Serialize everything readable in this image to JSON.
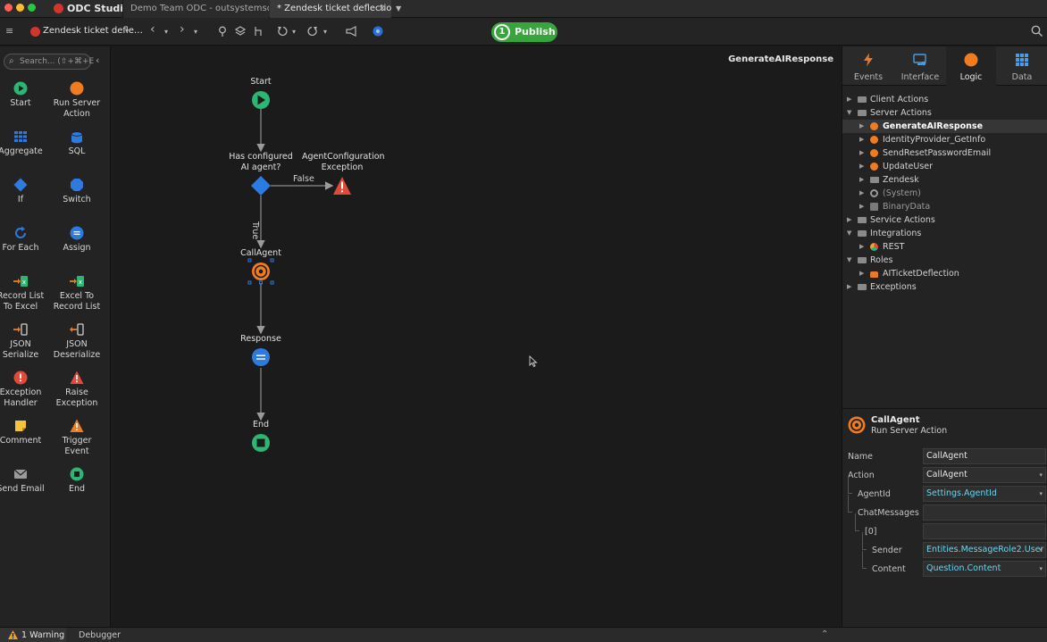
{
  "app": {
    "name": "ODC Studio",
    "window_tabs": [
      {
        "label": "Demo Team ODC - outsystemsdt.ou…",
        "active": false
      },
      {
        "label": "* Zendesk ticket deflection",
        "active": true
      }
    ],
    "tab_close": "×",
    "tab_dropdown": "▼"
  },
  "toolbar": {
    "menu_icon": "≡",
    "module_name": "Zendesk ticket defle…",
    "back": "‹",
    "forward": "›",
    "caret": "▾",
    "publish_number": "1",
    "publish_label": "Publish",
    "search_icon": "⌕"
  },
  "toolbox": {
    "search_placeholder": "Search... (⇧+⌘+E",
    "collapse": "‹",
    "tools": [
      {
        "label": "Start",
        "icon": "start-icon"
      },
      {
        "label": "Run Server Action",
        "icon": "run-server-action-icon"
      },
      {
        "label": "Aggregate",
        "icon": "aggregate-icon"
      },
      {
        "label": "SQL",
        "icon": "sql-icon"
      },
      {
        "label": "If",
        "icon": "if-icon"
      },
      {
        "label": "Switch",
        "icon": "switch-icon"
      },
      {
        "label": "For Each",
        "icon": "for-each-icon"
      },
      {
        "label": "Assign",
        "icon": "assign-icon"
      },
      {
        "label": "Record List To Excel",
        "icon": "record-list-to-excel-icon"
      },
      {
        "label": "Excel To Record List",
        "icon": "excel-to-record-list-icon"
      },
      {
        "label": "JSON Serialize",
        "icon": "json-serialize-icon"
      },
      {
        "label": "JSON Deserialize",
        "icon": "json-deserialize-icon"
      },
      {
        "label": "Exception Handler",
        "icon": "exception-handler-icon"
      },
      {
        "label": "Raise Exception",
        "icon": "raise-exception-icon"
      },
      {
        "label": "Comment",
        "icon": "comment-icon"
      },
      {
        "label": "Trigger Event",
        "icon": "trigger-event-icon"
      },
      {
        "label": "Send Email",
        "icon": "send-email-icon"
      },
      {
        "label": "End",
        "icon": "end-icon"
      }
    ]
  },
  "canvas": {
    "title": "GenerateAIResponse",
    "nodes": {
      "start": "Start",
      "if": "Has configured AI agent?",
      "exception": "AgentConfiguration Exception",
      "call": "CallAgent",
      "response": "Response",
      "end": "End"
    },
    "edges": {
      "false": "False",
      "true": "True"
    }
  },
  "right_panel": {
    "tabs": [
      {
        "label": "Events",
        "icon": "events-icon",
        "active": false
      },
      {
        "label": "Interface",
        "icon": "interface-icon",
        "active": false
      },
      {
        "label": "Logic",
        "icon": "logic-icon",
        "active": true
      },
      {
        "label": "Data",
        "icon": "data-icon",
        "active": false
      }
    ],
    "tree": [
      {
        "label": "Client Actions",
        "depth": 0,
        "arrow": "▶",
        "icon": "folder"
      },
      {
        "label": "Server Actions",
        "depth": 0,
        "arrow": "▼",
        "icon": "folder"
      },
      {
        "label": "GenerateAIResponse",
        "depth": 1,
        "arrow": "▶",
        "icon": "action",
        "selected": true
      },
      {
        "label": "IdentityProvider_GetInfo",
        "depth": 1,
        "arrow": "▶",
        "icon": "action"
      },
      {
        "label": "SendResetPasswordEmail",
        "depth": 1,
        "arrow": "▶",
        "icon": "action"
      },
      {
        "label": "UpdateUser",
        "depth": 1,
        "arrow": "▶",
        "icon": "action"
      },
      {
        "label": "Zendesk",
        "depth": 1,
        "arrow": "▶",
        "icon": "folder"
      },
      {
        "label": "(System)",
        "depth": 1,
        "arrow": "▶",
        "icon": "system"
      },
      {
        "label": "BinaryData",
        "depth": 1,
        "arrow": "▶",
        "icon": "binary"
      },
      {
        "label": "Service Actions",
        "depth": 0,
        "arrow": "▶",
        "icon": "folder"
      },
      {
        "label": "Integrations",
        "depth": 0,
        "arrow": "▼",
        "icon": "folder"
      },
      {
        "label": "REST",
        "depth": 1,
        "arrow": "▶",
        "icon": "rest"
      },
      {
        "label": "Roles",
        "depth": 0,
        "arrow": "▼",
        "icon": "folder"
      },
      {
        "label": "AITicketDeflection",
        "depth": 1,
        "arrow": "▶",
        "icon": "lock"
      },
      {
        "label": "Exceptions",
        "depth": 0,
        "arrow": "▶",
        "icon": "folder"
      }
    ],
    "properties": {
      "name": "CallAgent",
      "type": "Run Server Action",
      "rows": [
        {
          "label": "Name",
          "value": "CallAgent",
          "indent": 0,
          "expr": false,
          "dropdown": false
        },
        {
          "label": "Action",
          "value": "CallAgent",
          "indent": 0,
          "expr": false,
          "dropdown": true
        },
        {
          "label": "AgentId",
          "value": "Settings.AgentId",
          "indent": 1,
          "expr": true,
          "dropdown": true
        },
        {
          "label": "ChatMessages",
          "value": "",
          "indent": 1,
          "expr": false,
          "dropdown": false
        },
        {
          "label": "[0]",
          "value": "",
          "indent": 2,
          "expr": false,
          "dropdown": false
        },
        {
          "label": "Sender",
          "value": "Entities.MessageRole2.User",
          "indent": 3,
          "expr": true,
          "dropdown": true
        },
        {
          "label": "Content",
          "value": "Question.Content",
          "indent": 3,
          "expr": true,
          "dropdown": true
        }
      ]
    }
  },
  "statusbar": {
    "warning": "1 Warning",
    "debugger": "Debugger",
    "collapse": "⌃"
  },
  "colors": {
    "start_green": "#2bb673",
    "server_orange": "#f07c22",
    "flow_blue": "#2d7be0",
    "publish_green": "#38a43c",
    "exception_red": "#e04a3a"
  }
}
